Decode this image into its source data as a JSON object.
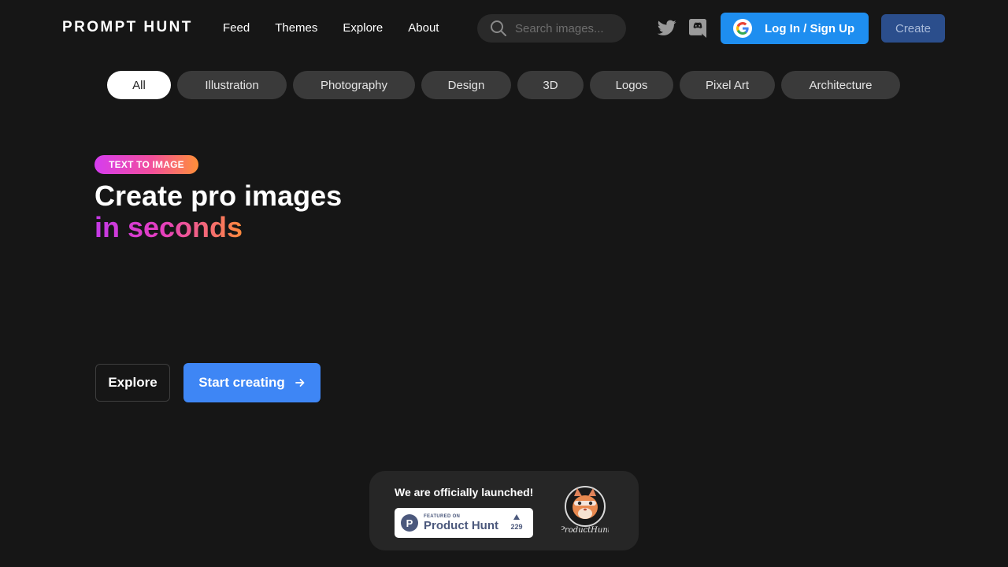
{
  "header": {
    "logo": "PROMPT HUNT",
    "nav": [
      "Feed",
      "Themes",
      "Explore",
      "About"
    ],
    "search_placeholder": "Search images...",
    "login_label": "Log In / Sign Up",
    "create_label": "Create"
  },
  "categories": [
    "All",
    "Illustration",
    "Photography",
    "Design",
    "3D",
    "Logos",
    "Pixel Art",
    "Architecture"
  ],
  "hero": {
    "badge": "TEXT TO IMAGE",
    "headline_line1": "Create pro images",
    "headline_line2": "in seconds",
    "explore_label": "Explore",
    "start_label": "Start creating"
  },
  "launch": {
    "title": "We are officially launched!",
    "featured_on": "FEATURED ON",
    "product_name": "Product Hunt",
    "upvotes": "229",
    "mascot_signature": "ProductHunt"
  },
  "colors": {
    "background": "#161616",
    "login_button": "#1e8ef0",
    "create_button": "#2b4e8c",
    "start_button": "#3e86f5",
    "gradient_start": "#d63cf0",
    "gradient_end": "#ff9038"
  },
  "icons": [
    "search-icon",
    "twitter-icon",
    "discord-icon",
    "google-icon",
    "arrow-right-icon",
    "producthunt-logo-icon",
    "upvote-triangle-icon",
    "kitty-mascot-icon"
  ]
}
